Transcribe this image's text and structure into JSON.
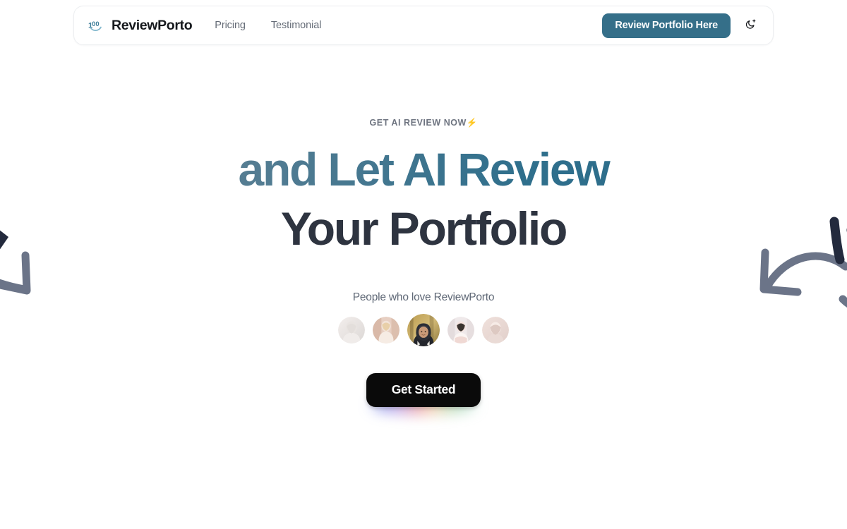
{
  "navbar": {
    "brand_name": "ReviewPorto",
    "logo_icon": "100-emoji-logo",
    "links": [
      {
        "label": "Pricing",
        "name": "nav-link-pricing"
      },
      {
        "label": "Testimonial",
        "name": "nav-link-testimonial"
      }
    ],
    "cta_label": "Review Portfolio Here",
    "cta_color": "#356f89",
    "theme_toggle_icon": "moon-sparkle-icon"
  },
  "hero": {
    "eyebrow_text": "GET AI REVIEW NOW",
    "eyebrow_emoji": "⚡",
    "headline_line1": "and Let AI Review",
    "headline_line2": "Your Portfolio",
    "headline_line1_gradient_from": "#6f8796",
    "headline_line1_gradient_to": "#2b6b88",
    "headline_line2_color": "#2e3440",
    "social_proof_label": "People who love ReviewPorto",
    "avatars": [
      {
        "name": "avatar-1",
        "alt": "user portrait 1"
      },
      {
        "name": "avatar-2",
        "alt": "user portrait 2"
      },
      {
        "name": "avatar-3-featured",
        "alt": "user portrait 3"
      },
      {
        "name": "avatar-4",
        "alt": "user portrait 4"
      },
      {
        "name": "avatar-5",
        "alt": "user portrait 5"
      }
    ],
    "cta_label": "Get Started",
    "cta_bg": "#0a0a0a"
  },
  "decorations": {
    "left_arrow": "curved-arrow-left-decoration",
    "right_arrow": "curved-arrow-right-decoration",
    "arrow_color": "#6b7488",
    "accent_color": "#232a3d"
  }
}
